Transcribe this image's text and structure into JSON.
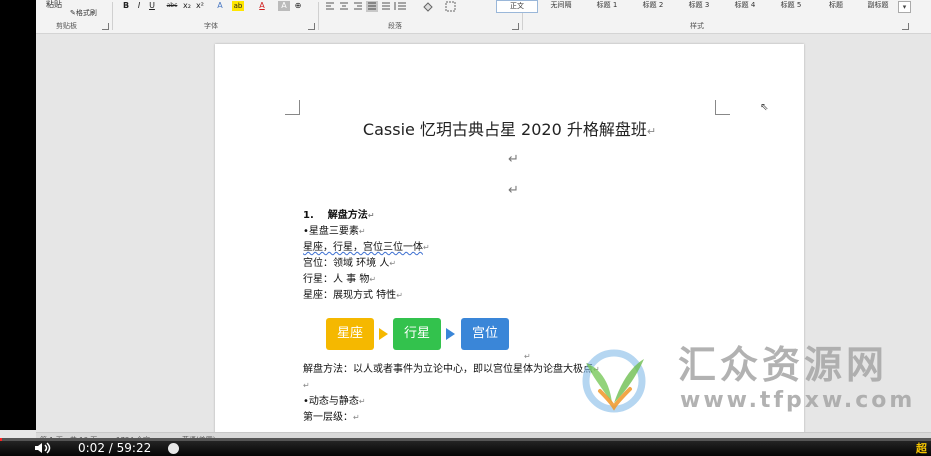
{
  "ribbon": {
    "paste_label": "粘贴",
    "format_painter_label": "格式刷",
    "sections": {
      "clipboard": "剪贴板",
      "font": "字体",
      "paragraph": "段落",
      "styles": "样式"
    },
    "font_buttons": [
      "B",
      "I",
      "U",
      "abc",
      "x₂",
      "x²",
      "A",
      "ab",
      "A",
      "A",
      "⊕"
    ],
    "styles": [
      "正文",
      "无间隔",
      "标题 1",
      "标题 2",
      "标题 3",
      "标题 4",
      "标题 5",
      "标题",
      "副标题"
    ],
    "selected_style": "正文"
  },
  "document": {
    "title": "Cassie 忆玥古典占星 2020 升格解盘班",
    "paragraph_mark": "↵",
    "heading_number": "1.",
    "heading_text": "解盘方法",
    "lines": [
      "•星盘三要素",
      "星座，行星，宫位三位一体",
      "宫位：领域  环境  人",
      "行星：人  事  物",
      "星座：展现方式  特性"
    ],
    "smartart": [
      {
        "label": "星座",
        "color": "#f5b800"
      },
      {
        "label": "行星",
        "color": "#33c24d"
      },
      {
        "label": "宫位",
        "color": "#3a86d8"
      }
    ],
    "method_line": "解盘方法：以人或者事件为立论中心，即以宫位星体为论盘大极点",
    "dynamic_line": "•动态与静态",
    "first_level": "第一层级："
  },
  "watermark": {
    "title": "汇众资源网",
    "url": "www.tfpxw.com"
  },
  "status_bar": {
    "page": "第 1 页，共 10 页",
    "words": "1734 个字",
    "language": "英语(美国)"
  },
  "video": {
    "current_time": "0:02",
    "separator": "/",
    "duration": "59:22",
    "progress": 0.0006,
    "corner_text": "超"
  }
}
